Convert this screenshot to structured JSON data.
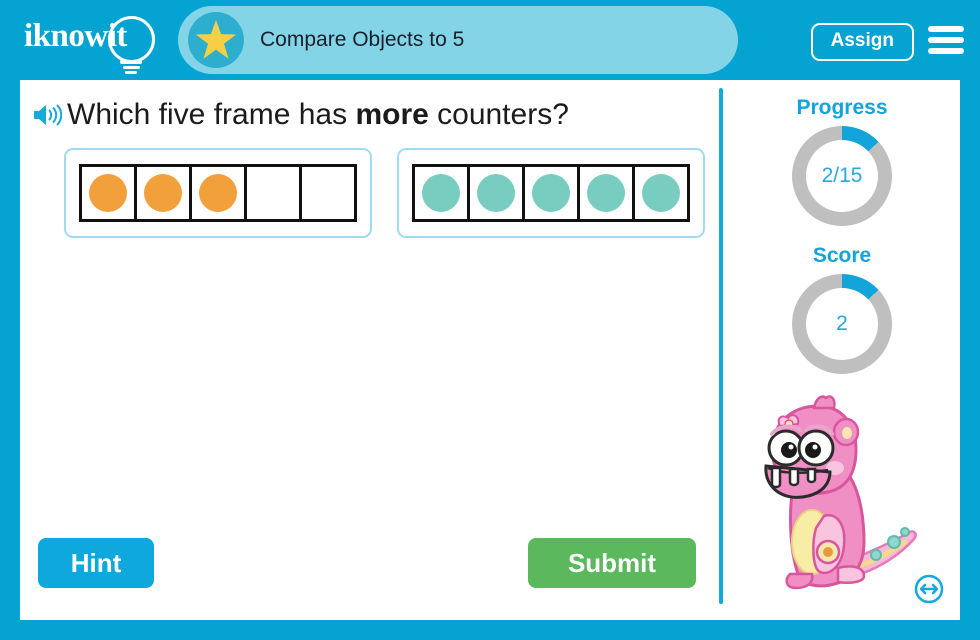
{
  "colors": {
    "brand_blue": "#04A3D2",
    "header_pill": "#84D4E8",
    "accent_blue": "#13A4DA",
    "counter_orange": "#F2A03C",
    "counter_teal": "#79CCC0",
    "submit_green": "#5CB85C",
    "star_yellow": "#F7CF45",
    "donut_track": "#BFBFBF",
    "mascot_pink": "#F096C8"
  },
  "header": {
    "logo_text": "iknowit",
    "logo_icon": "lightbulb-icon",
    "star_icon": "star-icon",
    "lesson_title": "Compare Objects to 5",
    "assign_label": "Assign",
    "menu_icon": "hamburger-menu-icon"
  },
  "question": {
    "audio_icon": "speaker-icon",
    "prefix": "Which five frame has ",
    "emphasis": "more",
    "suffix": " counters?"
  },
  "answers": [
    {
      "id": "frame-a",
      "counter_color": "#F2A03C",
      "counter_color_name": "orange",
      "cells": 5,
      "filled": 3
    },
    {
      "id": "frame-b",
      "counter_color": "#79CCC0",
      "counter_color_name": "teal",
      "cells": 5,
      "filled": 5
    }
  ],
  "actions": {
    "hint_label": "Hint",
    "submit_label": "Submit"
  },
  "sidebar": {
    "progress": {
      "label": "Progress",
      "value": "2/15",
      "current": 2,
      "total": 15,
      "percent": 13
    },
    "score": {
      "label": "Score",
      "value": "2",
      "percent": 13
    },
    "mascot_name": "pink-monster-mascot",
    "resize_icon": "resize-horizontal-icon"
  }
}
